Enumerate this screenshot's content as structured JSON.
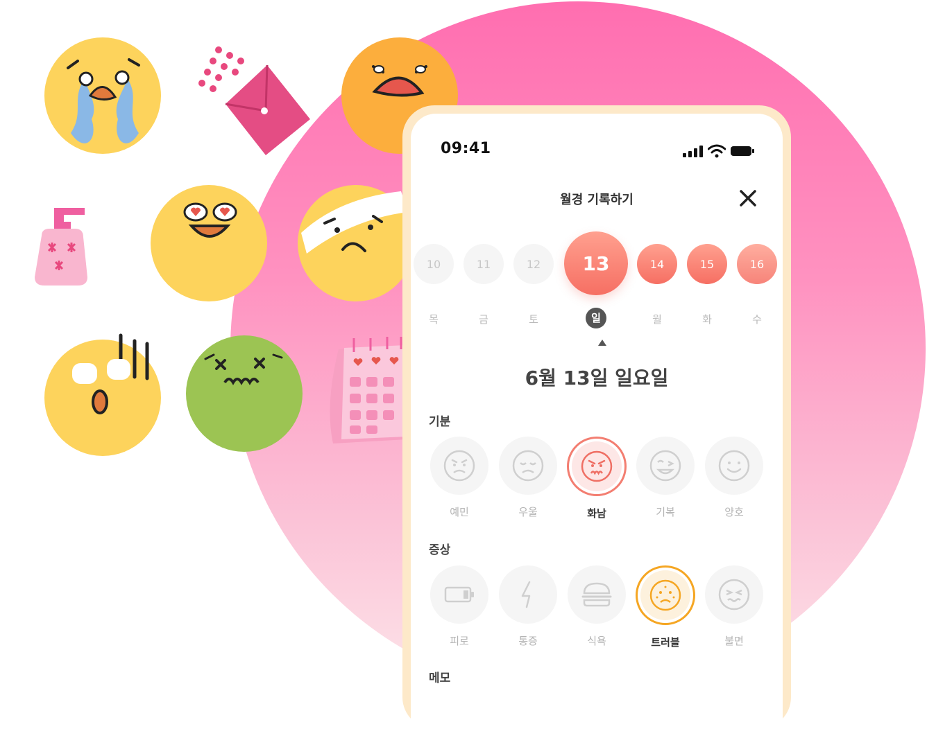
{
  "status_bar": {
    "time": "09:41"
  },
  "header": {
    "title": "월경 기록하기"
  },
  "dates": [
    {
      "day": "10",
      "weekday": "목"
    },
    {
      "day": "11",
      "weekday": "금"
    },
    {
      "day": "12",
      "weekday": "토"
    },
    {
      "day": "13",
      "weekday": "일",
      "selected": true
    },
    {
      "day": "14",
      "weekday": "월",
      "period": true
    },
    {
      "day": "15",
      "weekday": "화",
      "period": true
    },
    {
      "day": "16",
      "weekday": "수",
      "period": true
    }
  ],
  "selected_date_title": "6월 13일 일요일",
  "mood": {
    "label": "기분",
    "options": [
      {
        "label": "예민",
        "icon": "sensitive-face-icon"
      },
      {
        "label": "우울",
        "icon": "sad-face-icon"
      },
      {
        "label": "화남",
        "icon": "angry-face-icon",
        "selected": true
      },
      {
        "label": "기복",
        "icon": "wink-face-icon"
      },
      {
        "label": "양호",
        "icon": "smile-face-icon"
      }
    ]
  },
  "symptoms": {
    "label": "증상",
    "options": [
      {
        "label": "피로",
        "icon": "battery-icon"
      },
      {
        "label": "통증",
        "icon": "lightning-icon"
      },
      {
        "label": "식욕",
        "icon": "burger-icon"
      },
      {
        "label": "트러블",
        "icon": "acne-face-icon",
        "selected": true
      },
      {
        "label": "불면",
        "icon": "sleepless-face-icon"
      }
    ]
  },
  "memo": {
    "label": "메모"
  },
  "colors": {
    "accent_red": "#f66f63",
    "accent_orange": "#f5a623",
    "background_pink": "#ff6eb0"
  }
}
